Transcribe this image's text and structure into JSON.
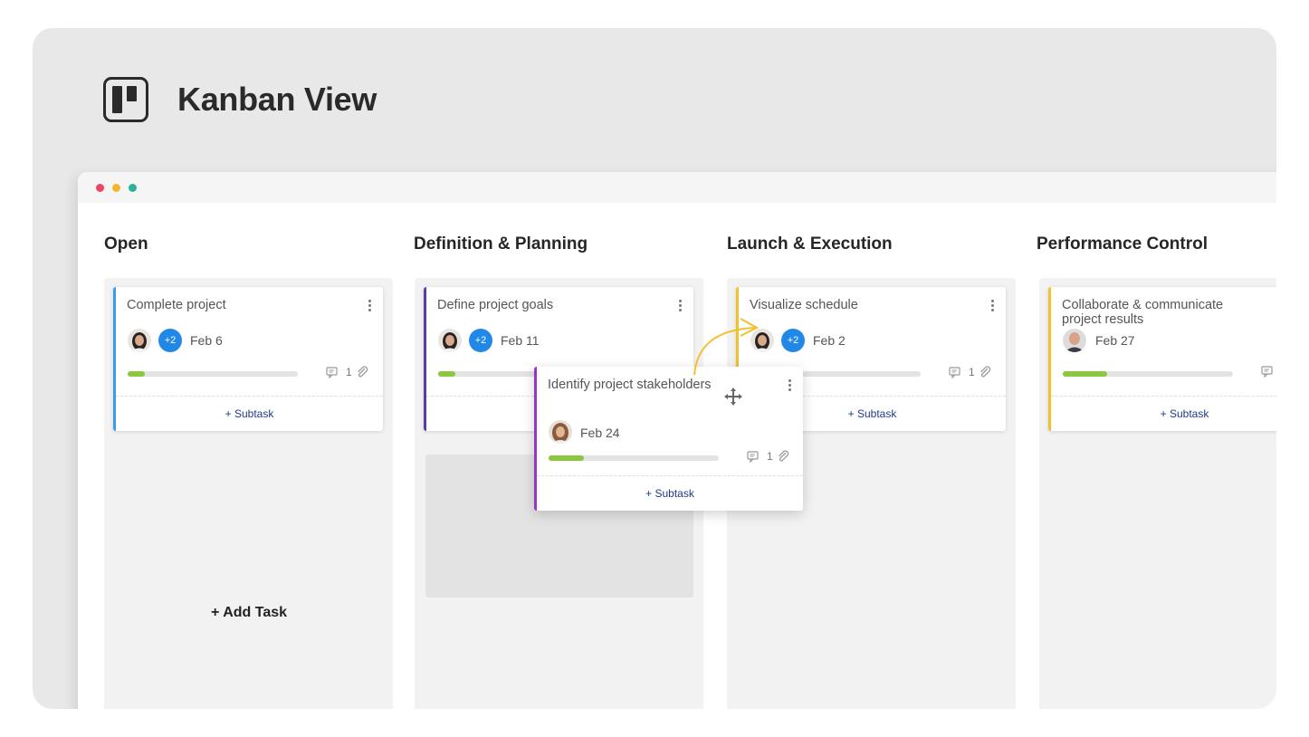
{
  "page": {
    "title": "Kanban View"
  },
  "window": {
    "dot_colors": [
      "#ef4565",
      "#f4b632",
      "#2bb29b"
    ]
  },
  "columns": [
    {
      "title": "Open",
      "add_task": "+ Add Task"
    },
    {
      "title": "Definition & Planning"
    },
    {
      "title": "Launch & Execution"
    },
    {
      "title": "Performance Control"
    }
  ],
  "cards": {
    "complete_project": {
      "title": "Complete project",
      "badge": "+2",
      "date": "Feb 6",
      "count": "1",
      "subtask": "+ Subtask",
      "progress": 0.1,
      "accent": "#3d9be9"
    },
    "define_goals": {
      "title": "Define project goals",
      "badge": "+2",
      "date": "Feb 11",
      "progress": 0.1,
      "accent": "#5a3ea8"
    },
    "visualize_schedule": {
      "title": "Visualize schedule",
      "badge": "+2",
      "date": "Feb 2",
      "count": "1",
      "subtask": "+ Subtask",
      "accent": "#f2c12e"
    },
    "collaborate": {
      "title": "Collaborate & communicate project results",
      "date": "Feb 27",
      "subtask": "+ Subtask",
      "progress": 0.26,
      "accent": "#f2c12e"
    },
    "stakeholders": {
      "title": "Identify project stakeholders",
      "date": "Feb 24",
      "count": "1",
      "subtask": "+ Subtask",
      "progress": 0.21,
      "accent": "#9b32c8"
    }
  }
}
